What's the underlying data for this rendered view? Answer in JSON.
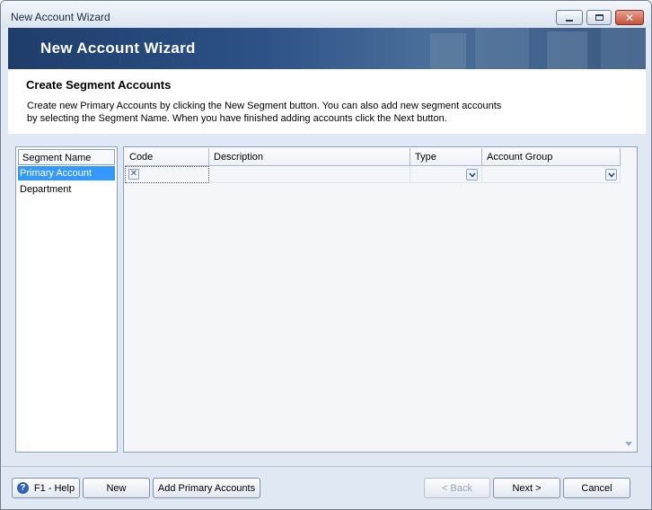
{
  "window": {
    "title": "New Account Wizard",
    "banner_title": "New Account Wizard"
  },
  "header": {
    "heading": "Create Segment Accounts",
    "description": "Create new Primary Accounts by clicking the New Segment button. You can also add new segment accounts by selecting the Segment Name. When you have finished adding accounts click the Next button."
  },
  "segments": {
    "column_header": "Segment Name",
    "items": [
      {
        "label": "Primary Account",
        "selected": true
      },
      {
        "label": "Department",
        "selected": false
      }
    ]
  },
  "grid": {
    "columns": [
      "Code",
      "Description",
      "Type",
      "Account Group"
    ],
    "row": {
      "code": "",
      "description": "",
      "type": "",
      "account_group": ""
    }
  },
  "buttons": {
    "help": "F1 - Help",
    "new": "New",
    "add_primary": "Add Primary Accounts",
    "back": "< Back",
    "next": "Next >",
    "cancel": "Cancel"
  },
  "colors": {
    "selection": "#3399ff",
    "banner": "#2c5287"
  }
}
